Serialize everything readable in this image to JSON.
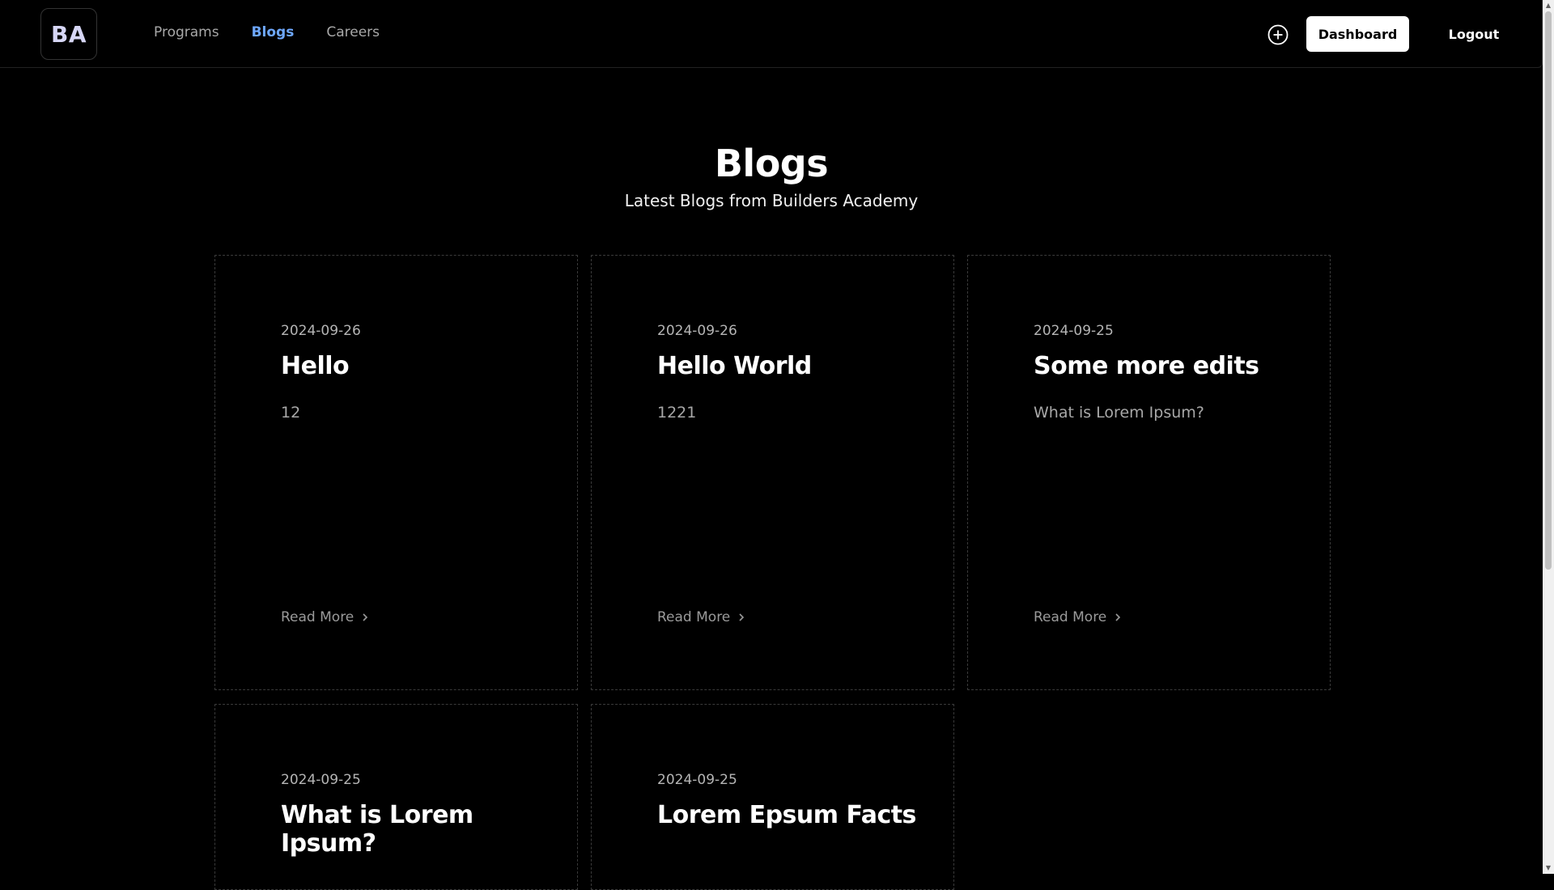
{
  "header": {
    "logo_text": "BA",
    "nav": [
      {
        "label": "Programs",
        "active": false
      },
      {
        "label": "Blogs",
        "active": true
      },
      {
        "label": "Careers",
        "active": false
      }
    ],
    "dashboard_label": "Dashboard",
    "logout_label": "Logout",
    "accent_color": "#6ea8ff"
  },
  "main": {
    "title": "Blogs",
    "subtitle": "Latest Blogs from Builders Academy",
    "cards": [
      {
        "date": "2024-09-26",
        "title": "Hello",
        "excerpt": "12",
        "read_more": "Read More"
      },
      {
        "date": "2024-09-26",
        "title": "Hello World",
        "excerpt": "1221",
        "read_more": "Read More"
      },
      {
        "date": "2024-09-25",
        "title": "Some more edits",
        "excerpt": "What is Lorem Ipsum?",
        "read_more": "Read More"
      },
      {
        "date": "2024-09-25",
        "title": "What is Lorem Ipsum?",
        "excerpt": "",
        "read_more": ""
      },
      {
        "date": "2024-09-25",
        "title": "Lorem Epsum Facts",
        "excerpt": "",
        "read_more": ""
      }
    ]
  }
}
